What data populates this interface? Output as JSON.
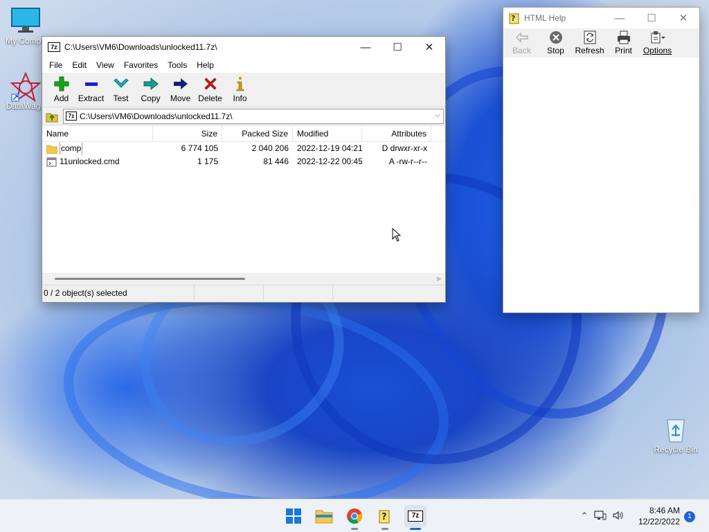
{
  "desktop": {
    "icons": [
      {
        "label": "My Compu",
        "icon": "monitor-icon"
      },
      {
        "label": "DataWago",
        "icon": "datawagon-icon"
      },
      {
        "label": "Recycle Bin",
        "icon": "recycle-bin-icon"
      }
    ]
  },
  "zip_window": {
    "badge": "7z",
    "title": "C:\\Users\\VM6\\Downloads\\unlocked11.7z\\",
    "controls": {
      "minimize": "—",
      "maximize": "☐",
      "close": "✕"
    },
    "menu": [
      "File",
      "Edit",
      "View",
      "Favorites",
      "Tools",
      "Help"
    ],
    "toolbar": [
      {
        "label": "Add",
        "icon": "add-icon",
        "color": "#1aa31a"
      },
      {
        "label": "Extract",
        "icon": "extract-icon",
        "color": "#1a1ad6"
      },
      {
        "label": "Test",
        "icon": "test-icon",
        "color": "#1ab0c8"
      },
      {
        "label": "Copy",
        "icon": "copy-icon",
        "color": "#14a08c"
      },
      {
        "label": "Move",
        "icon": "move-icon",
        "color": "#12207a"
      },
      {
        "label": "Delete",
        "icon": "delete-icon",
        "color": "#d21414"
      },
      {
        "label": "Info",
        "icon": "info-icon",
        "color": "#c8a000"
      }
    ],
    "address": "C:\\Users\\VM6\\Downloads\\unlocked11.7z\\",
    "columns": [
      "Name",
      "Size",
      "Packed Size",
      "Modified",
      "Attributes"
    ],
    "rows": [
      {
        "name": "comp",
        "size": "6 774 105",
        "packed": "2 040 206",
        "modified": "2022-12-19 04:21",
        "attributes": "D drwxr-xr-x",
        "icon": "folder-icon"
      },
      {
        "name": "11unlocked.cmd",
        "size": "1 175",
        "packed": "81 446",
        "modified": "2022-12-22 00:45",
        "attributes": "A -rw-r--r--",
        "icon": "file-icon"
      }
    ],
    "status": "0 / 2 object(s) selected"
  },
  "help_window": {
    "title": "HTML Help",
    "controls": {
      "minimize": "—",
      "maximize": "☐",
      "close": "✕"
    },
    "toolbar": [
      {
        "label": "Back",
        "icon": "back-arrow-icon",
        "enabled": false
      },
      {
        "label": "Stop",
        "icon": "stop-icon",
        "enabled": true
      },
      {
        "label": "Refresh",
        "icon": "refresh-icon",
        "enabled": true
      },
      {
        "label": "Print",
        "icon": "printer-icon",
        "enabled": true
      },
      {
        "label": "Options",
        "icon": "options-icon",
        "enabled": true
      }
    ]
  },
  "taskbar": {
    "time": "8:46 AM",
    "date": "12/22/2022",
    "notifications": "1",
    "accent": "#1e63d6"
  }
}
